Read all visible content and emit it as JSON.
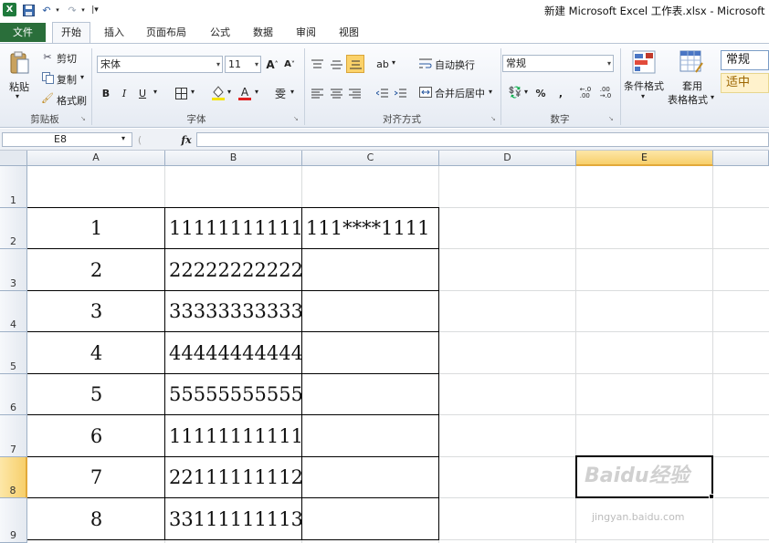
{
  "titlebar": {
    "title": "新建 Microsoft Excel 工作表.xlsx - Microsoft Ex"
  },
  "tabs": [
    {
      "label": "文件"
    },
    {
      "label": "开始"
    },
    {
      "label": "插入"
    },
    {
      "label": "页面布局"
    },
    {
      "label": "公式"
    },
    {
      "label": "数据"
    },
    {
      "label": "审阅"
    },
    {
      "label": "视图"
    }
  ],
  "ribbon": {
    "clipboard": {
      "paste": "粘贴",
      "cut": "剪切",
      "copy": "复制",
      "format_painter": "格式刷",
      "label": "剪贴板"
    },
    "font": {
      "name": "宋体",
      "size": "11",
      "label": "字体"
    },
    "alignment": {
      "wrap": "自动换行",
      "merge": "合并后居中",
      "label": "对齐方式"
    },
    "number": {
      "format": "常规",
      "label": "数字"
    },
    "styles": {
      "conditional": "条件格式",
      "table_format_1": "套用",
      "table_format_2": "表格格式",
      "normal": "常规",
      "neutral": "适中"
    }
  },
  "formula_bar": {
    "name_box": "E8",
    "fx": "fx",
    "value": ""
  },
  "columns": [
    "A",
    "B",
    "C",
    "D",
    "E"
  ],
  "rows": [
    "1",
    "2",
    "3",
    "4",
    "5",
    "6",
    "7",
    "8",
    "9"
  ],
  "table": [
    {
      "a": "1",
      "b": "11111111111",
      "c": "111****1111"
    },
    {
      "a": "2",
      "b": "22222222222",
      "c": ""
    },
    {
      "a": "3",
      "b": "33333333333",
      "c": ""
    },
    {
      "a": "4",
      "b": "44444444444",
      "c": ""
    },
    {
      "a": "5",
      "b": "55555555555",
      "c": ""
    },
    {
      "a": "6",
      "b": "11111111111",
      "c": ""
    },
    {
      "a": "7",
      "b": "22111111112",
      "c": ""
    },
    {
      "a": "8",
      "b": "33111111113",
      "c": ""
    }
  ],
  "watermark": {
    "main": "Baidu经验",
    "sub": "jingyan.baidu.com"
  }
}
